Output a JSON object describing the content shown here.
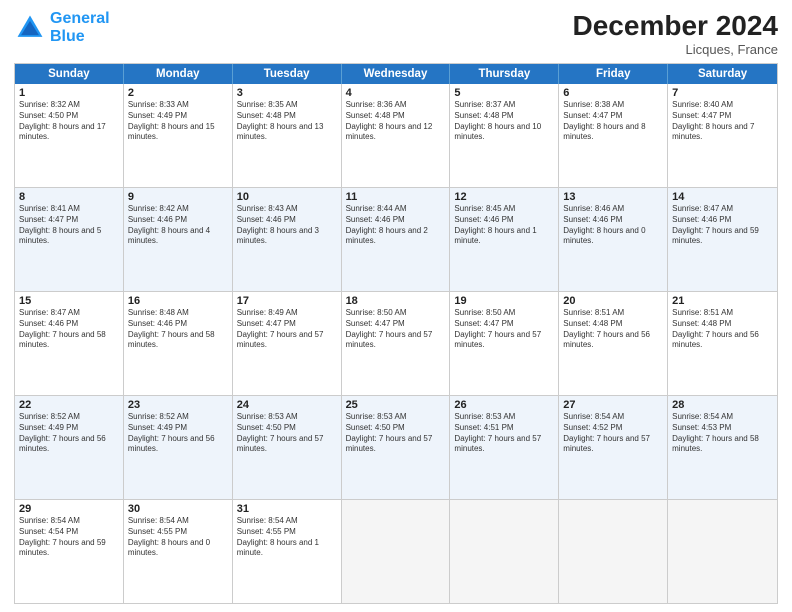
{
  "header": {
    "logo_general": "General",
    "logo_blue": "Blue",
    "month_title": "December 2024",
    "location": "Licques, France"
  },
  "days_of_week": [
    "Sunday",
    "Monday",
    "Tuesday",
    "Wednesday",
    "Thursday",
    "Friday",
    "Saturday"
  ],
  "rows": [
    {
      "alt": false,
      "cells": [
        {
          "day": "1",
          "sunrise": "8:32 AM",
          "sunset": "4:50 PM",
          "daylight": "8 hours and 17 minutes."
        },
        {
          "day": "2",
          "sunrise": "8:33 AM",
          "sunset": "4:49 PM",
          "daylight": "8 hours and 15 minutes."
        },
        {
          "day": "3",
          "sunrise": "8:35 AM",
          "sunset": "4:48 PM",
          "daylight": "8 hours and 13 minutes."
        },
        {
          "day": "4",
          "sunrise": "8:36 AM",
          "sunset": "4:48 PM",
          "daylight": "8 hours and 12 minutes."
        },
        {
          "day": "5",
          "sunrise": "8:37 AM",
          "sunset": "4:48 PM",
          "daylight": "8 hours and 10 minutes."
        },
        {
          "day": "6",
          "sunrise": "8:38 AM",
          "sunset": "4:47 PM",
          "daylight": "8 hours and 8 minutes."
        },
        {
          "day": "7",
          "sunrise": "8:40 AM",
          "sunset": "4:47 PM",
          "daylight": "8 hours and 7 minutes."
        }
      ]
    },
    {
      "alt": true,
      "cells": [
        {
          "day": "8",
          "sunrise": "8:41 AM",
          "sunset": "4:47 PM",
          "daylight": "8 hours and 5 minutes."
        },
        {
          "day": "9",
          "sunrise": "8:42 AM",
          "sunset": "4:46 PM",
          "daylight": "8 hours and 4 minutes."
        },
        {
          "day": "10",
          "sunrise": "8:43 AM",
          "sunset": "4:46 PM",
          "daylight": "8 hours and 3 minutes."
        },
        {
          "day": "11",
          "sunrise": "8:44 AM",
          "sunset": "4:46 PM",
          "daylight": "8 hours and 2 minutes."
        },
        {
          "day": "12",
          "sunrise": "8:45 AM",
          "sunset": "4:46 PM",
          "daylight": "8 hours and 1 minute."
        },
        {
          "day": "13",
          "sunrise": "8:46 AM",
          "sunset": "4:46 PM",
          "daylight": "8 hours and 0 minutes."
        },
        {
          "day": "14",
          "sunrise": "8:47 AM",
          "sunset": "4:46 PM",
          "daylight": "7 hours and 59 minutes."
        }
      ]
    },
    {
      "alt": false,
      "cells": [
        {
          "day": "15",
          "sunrise": "8:47 AM",
          "sunset": "4:46 PM",
          "daylight": "7 hours and 58 minutes."
        },
        {
          "day": "16",
          "sunrise": "8:48 AM",
          "sunset": "4:46 PM",
          "daylight": "7 hours and 58 minutes."
        },
        {
          "day": "17",
          "sunrise": "8:49 AM",
          "sunset": "4:47 PM",
          "daylight": "7 hours and 57 minutes."
        },
        {
          "day": "18",
          "sunrise": "8:50 AM",
          "sunset": "4:47 PM",
          "daylight": "7 hours and 57 minutes."
        },
        {
          "day": "19",
          "sunrise": "8:50 AM",
          "sunset": "4:47 PM",
          "daylight": "7 hours and 57 minutes."
        },
        {
          "day": "20",
          "sunrise": "8:51 AM",
          "sunset": "4:48 PM",
          "daylight": "7 hours and 56 minutes."
        },
        {
          "day": "21",
          "sunrise": "8:51 AM",
          "sunset": "4:48 PM",
          "daylight": "7 hours and 56 minutes."
        }
      ]
    },
    {
      "alt": true,
      "cells": [
        {
          "day": "22",
          "sunrise": "8:52 AM",
          "sunset": "4:49 PM",
          "daylight": "7 hours and 56 minutes."
        },
        {
          "day": "23",
          "sunrise": "8:52 AM",
          "sunset": "4:49 PM",
          "daylight": "7 hours and 56 minutes."
        },
        {
          "day": "24",
          "sunrise": "8:53 AM",
          "sunset": "4:50 PM",
          "daylight": "7 hours and 57 minutes."
        },
        {
          "day": "25",
          "sunrise": "8:53 AM",
          "sunset": "4:50 PM",
          "daylight": "7 hours and 57 minutes."
        },
        {
          "day": "26",
          "sunrise": "8:53 AM",
          "sunset": "4:51 PM",
          "daylight": "7 hours and 57 minutes."
        },
        {
          "day": "27",
          "sunrise": "8:54 AM",
          "sunset": "4:52 PM",
          "daylight": "7 hours and 57 minutes."
        },
        {
          "day": "28",
          "sunrise": "8:54 AM",
          "sunset": "4:53 PM",
          "daylight": "7 hours and 58 minutes."
        }
      ]
    },
    {
      "alt": false,
      "cells": [
        {
          "day": "29",
          "sunrise": "8:54 AM",
          "sunset": "4:54 PM",
          "daylight": "7 hours and 59 minutes."
        },
        {
          "day": "30",
          "sunrise": "8:54 AM",
          "sunset": "4:55 PM",
          "daylight": "8 hours and 0 minutes."
        },
        {
          "day": "31",
          "sunrise": "8:54 AM",
          "sunset": "4:55 PM",
          "daylight": "8 hours and 1 minute."
        },
        {
          "day": "",
          "sunrise": "",
          "sunset": "",
          "daylight": ""
        },
        {
          "day": "",
          "sunrise": "",
          "sunset": "",
          "daylight": ""
        },
        {
          "day": "",
          "sunrise": "",
          "sunset": "",
          "daylight": ""
        },
        {
          "day": "",
          "sunrise": "",
          "sunset": "",
          "daylight": ""
        }
      ]
    }
  ],
  "labels": {
    "sunrise": "Sunrise:",
    "sunset": "Sunset:",
    "daylight": "Daylight:"
  }
}
